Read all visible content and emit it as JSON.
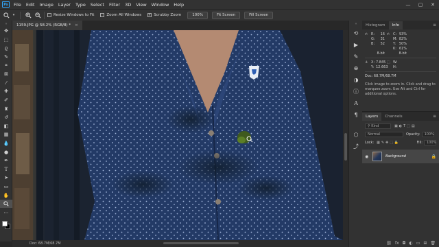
{
  "menu": {
    "logo": "Ps",
    "items": [
      "File",
      "Edit",
      "Image",
      "Layer",
      "Type",
      "Select",
      "Filter",
      "3D",
      "View",
      "Window",
      "Help"
    ],
    "minimize": "—",
    "maximize": "▢",
    "close": "✕"
  },
  "options_bar": {
    "resize_windows": "Resize Windows to Fit",
    "zoom_all": "Zoom All Windows",
    "scrubby_zoom": "Scrubby Zoom",
    "zoom_100": "100%",
    "fit_screen": "Fit Screen",
    "fill_screen": "Fill Screen"
  },
  "document": {
    "tab_title": "1159.JPG @ 58.2% (RGB/8) *",
    "tab_close": "×",
    "status": "Doc: 68.7M/68.7M"
  },
  "panels": {
    "histogram_tab": "Histogram",
    "info_tab": "Info",
    "menu_icon": "≡",
    "info_rgb": {
      "R": "16",
      "G": "31",
      "B": "52"
    },
    "info_cmyk": {
      "C": "93%",
      "M": "82%",
      "Y": "50%",
      "K": "61%"
    },
    "bit_depth": "8-bit",
    "x_value": "7.845",
    "y_value": "12.663",
    "w_value": "",
    "h_value": "",
    "doc": "Doc: 68.7M/68.7M",
    "hint": "Click image to zoom in. Click and drag to marquee zoom. Use Alt and Ctrl for additional options."
  },
  "layers": {
    "layers_tab": "Layers",
    "channels_tab": "Channels",
    "kind": "Kind",
    "blend_mode": "Normal",
    "opacity_label": "Opacity:",
    "opacity": "100%",
    "lock_label": "Lock:",
    "fill_label": "Fill:",
    "fill": "100%",
    "layer_name": "Background"
  },
  "colors": {
    "shirt": "#233a66",
    "background_dark": "#1a2230",
    "accent": "#31a8ff"
  }
}
